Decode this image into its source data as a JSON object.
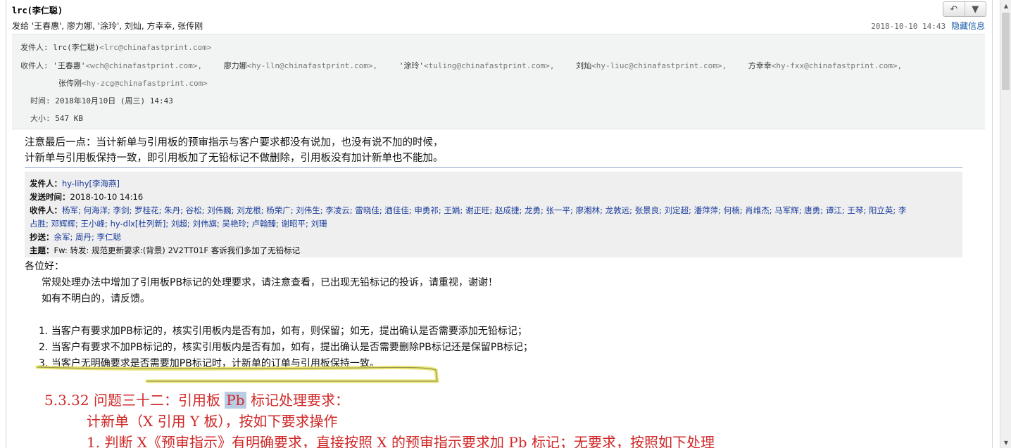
{
  "header": {
    "sender": "lrc(李仁聪)",
    "sent_to": "发给 '王春惠', 廖力娜, '涂玲', 刘灿, 方幸幸, 张传刚",
    "date": "2018-10-10 14:43",
    "hide_info": "隐藏信息",
    "reply_icon": "reply-arrow",
    "dropdown_icon": "triangle-down"
  },
  "info": {
    "from_label": "发件人:",
    "from_name": "lrc(李仁聪)",
    "from_addr": "<lrc@chinafastprint.com>",
    "to_label": "收件人:",
    "recipients": [
      {
        "name": "'王春惠'",
        "addr": "<wch@chinafastprint.com>,"
      },
      {
        "name": "廖力娜",
        "addr": "<hy-lln@chinafastprint.com>,"
      },
      {
        "name": "'涂玲'",
        "addr": "<tuling@chinafastprint.com>,"
      },
      {
        "name": "刘灿",
        "addr": "<hy-liuc@chinafastprint.com>,"
      },
      {
        "name": "方幸幸",
        "addr": "<hy-fxx@chinafastprint.com>,"
      }
    ],
    "recipient_last": {
      "name": "张传刚",
      "addr": "<hy-zcg@chinafastprint.com>"
    },
    "time_label": "时间:",
    "time_value": "2018年10月10日 (周三) 14:43",
    "size_label": "大小:",
    "size_value": "547 KB"
  },
  "body": {
    "line1": "注意最后一点：当计新单与引用板的预审指示与客户要求都没有说加，也没有说不加的时候，",
    "line2": "计新单与引用板保持一致，即引用板加了无铅标记不做删除，引用板没有加计新单也不能加。"
  },
  "quote": {
    "from_label": "发件人：",
    "from_value": "hy-lihy[李海燕]",
    "sent_label": "发送时间：",
    "sent_value": "2018-10-10 14:16",
    "to_label": "收件人：",
    "to_value_line1": "杨军; 何海洋; 李剑; 罗桂花; 朱丹; 谷松; 刘伟巍; 刘龙根; 杨荣广; 刘伟生; 李凌云; 雷晓佳; 酒佳佳; 申勇祁; 王娟; 谢正旺; 赵成捷; 龙勇; 张一平; 廖湘林; 龙敦远; 张景良; 刘定超; 潘萍萍; 何楠; 肖维杰; 马军辉; 唐勇; 谭江; 王琴; 阳立英; 李",
    "to_value_line2": "占胜; 邓辉辉; 王小峰; hy-dlx[杜列新]; 刘超; 刘伟旗; 吴艳玲; 卢翰臻; 谢昭平; 刘珊",
    "cc_label": "抄送：",
    "cc_value": "余军; 周丹; 李仁聪",
    "subject_label": "主题：",
    "subject_value": "Fw: 转发: 规范更新要求:(背景) 2V2TT01F 客诉我们多加了无铅标记"
  },
  "letter": {
    "greeting": "各位好：",
    "p1": "常规处理办法中增加了引用板PB标记的处理要求，请注意查看，已出现无铅标记的投诉，请重视，谢谢！",
    "p2": "如有不明白的，请反馈。",
    "items": [
      "1. 当客户有要求加PB标记的，核实引用板内是否有加，如有，则保留；如无，提出确认是否需要添加无铅标记；",
      "2. 当客户有要求不加PB标记的，核实引用板内是否有加，如有，提出确认是否需要删除PB标记还是保留PB标记；",
      "3. 当客户无明确要求是否需要加PB标记时，计新单的订单与引用板保持一致。"
    ]
  },
  "excerpt": {
    "title_pre": "5.3.32 问题三十二：引用板",
    "title_hl": "Pb",
    "title_post": "标记处理要求：",
    "line2": "计新单（X 引用 Y 板），按如下要求操作",
    "line3": "1. 判断 X《预审指示》有明确要求，直接按照 X 的预审指示要求加 Pb 标记；无要求，按照如下处理"
  }
}
